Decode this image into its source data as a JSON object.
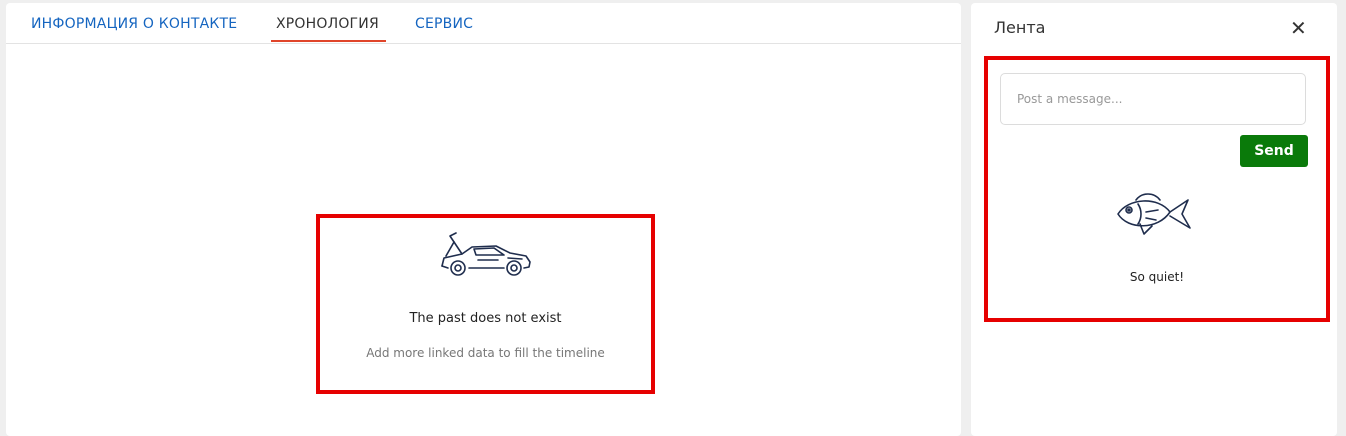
{
  "tabs": [
    {
      "label": "ИНФОРМАЦИЯ О КОНТАКТЕ"
    },
    {
      "label": "ХРОНОЛОГИЯ",
      "active": true
    },
    {
      "label": "СЕРВИС"
    }
  ],
  "timeline": {
    "empty_icon": "car-icon",
    "empty_title": "The past does not exist",
    "empty_subtitle": "Add more linked data to fill the timeline"
  },
  "feed": {
    "title": "Лента",
    "close_icon": "close-icon",
    "input_placeholder": "Post a message...",
    "send_label": "Send",
    "empty_icon": "fish-icon",
    "empty_text": "So quiet!"
  },
  "colors": {
    "accent_tab": "#1565c0",
    "active_underline": "#e0452a",
    "send_button": "#0a7a0a",
    "highlight_border": "#e60000"
  }
}
